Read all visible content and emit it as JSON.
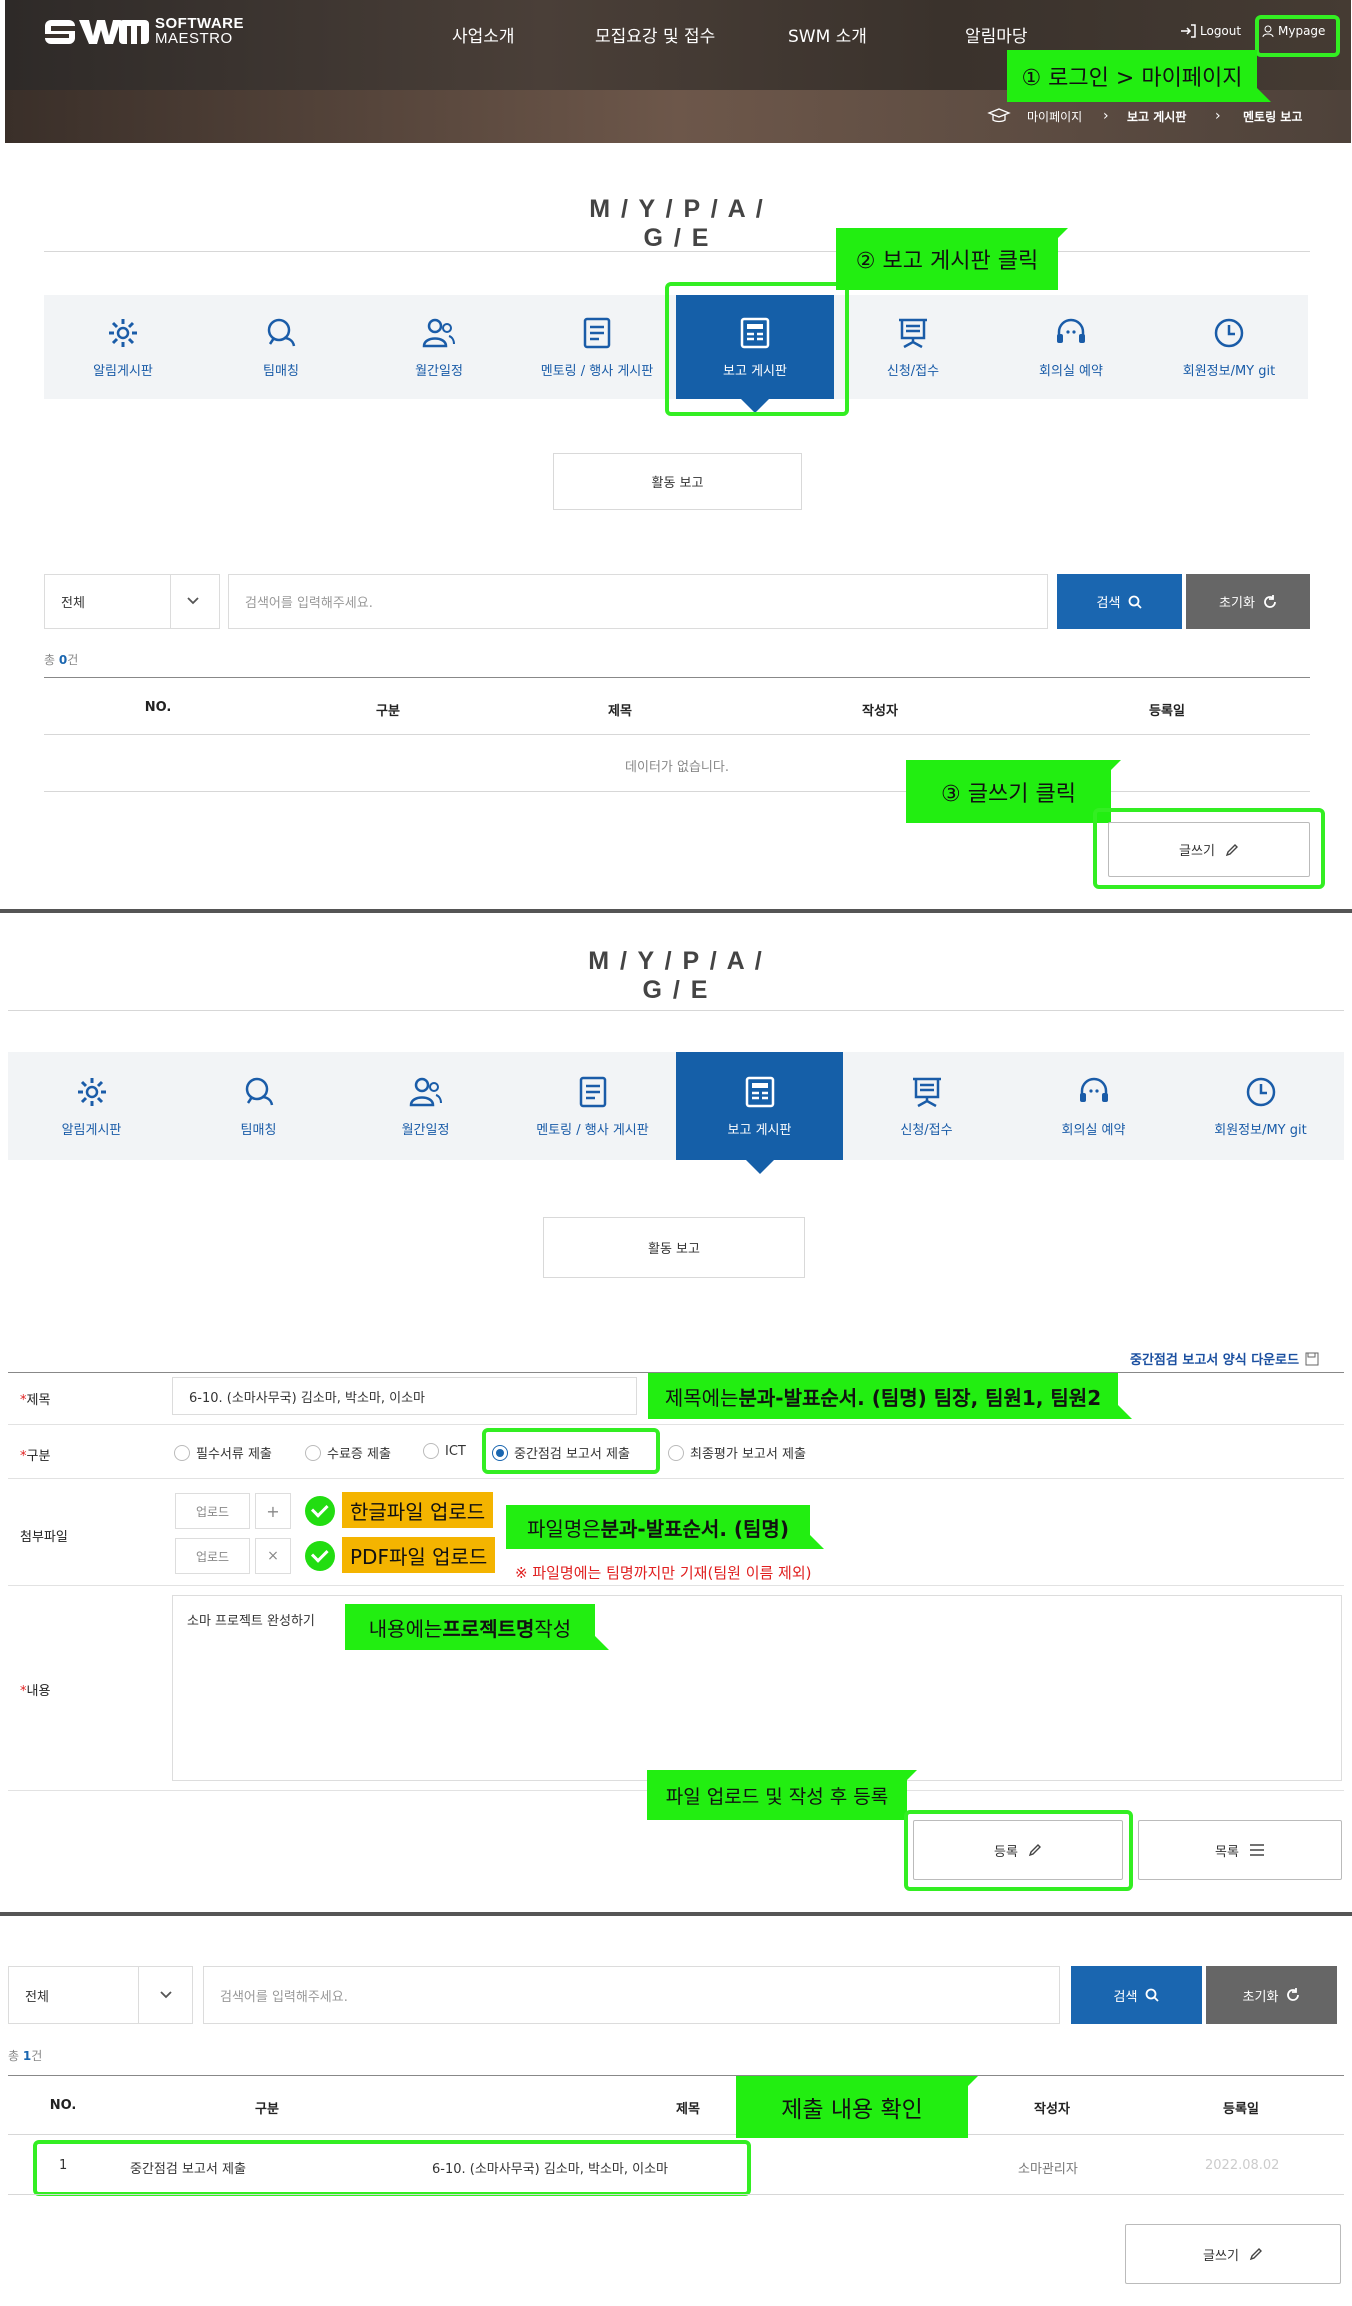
{
  "header": {
    "logo_line1": "SOFTWARE",
    "logo_line2": "MAESTRO",
    "nav": [
      "사업소개",
      "모집요강 및 접수",
      "SWM 소개",
      "알림마당"
    ],
    "logout": "Logout",
    "mypage": "Mypage",
    "breadcrumb": [
      "마이페이지",
      "보고 게시판",
      "멘토링 보고"
    ]
  },
  "mypage_title": "M / Y / P / A / G / E",
  "tabs": [
    "알림게시판",
    "팀매칭",
    "월간일정",
    "멘토링 / 행사 게시판",
    "보고 게시판",
    "신청/접수",
    "회의실 예약",
    "회원정보/MY git"
  ],
  "sub_tab": "활동 보고",
  "search": {
    "select_value": "전체",
    "placeholder": "검색어를 입력해주세요.",
    "search_label": "검색",
    "reset_label": "초기화"
  },
  "list1": {
    "total_prefix": "총 ",
    "total_count": "0",
    "total_suffix": "건",
    "columns": [
      "NO.",
      "구분",
      "제목",
      "작성자",
      "등록일"
    ],
    "empty": "데이터가 없습니다."
  },
  "write_label": "글쓰기",
  "annotations": {
    "step1": "① 로그인 > 마이페이지",
    "step2": "② 보고 게시판 클릭",
    "step3": "③ 글쓰기 클릭",
    "title_note_plain": "제목에는 ",
    "title_note_bold": "분과-발표순서. (팀명) 팀장, 팀원1, 팀원2",
    "hwp_note": "한글파일 업로드",
    "pdf_note": "PDF파일 업로드",
    "file_note_plain": "파일명은 ",
    "file_note_bold": "분과-발표순서. (팀명)",
    "file_warning": "※ 파일명에는 팀명까지만 기재(팀원 이름 제외)",
    "content_note_plain": "내용에는 ",
    "content_note_bold": "프로젝트명",
    "content_note_tail": " 작성",
    "submit_note": "파일 업로드 및 작성 후 등록",
    "check_note": "제출 내용 확인"
  },
  "form": {
    "download_link": "중간점검 보고서 양식 다운로드",
    "title_label": "제목",
    "title_value": "6-10. (소마사무국) 김소마, 박소마, 이소마",
    "category_label": "구분",
    "categories": [
      "필수서류 제출",
      "수료증 제출",
      "ICT",
      "중간점검 보고서 제출",
      "최종평가 보고서 제출"
    ],
    "selected_category": "중간점검 보고서 제출",
    "attach_label": "첨부파일",
    "upload_label": "업로드",
    "content_label": "내용",
    "content_value": "소마 프로젝트 완성하기",
    "submit_label": "등록",
    "list_label": "목록"
  },
  "list2": {
    "total_prefix": "총 ",
    "total_count": "1",
    "total_suffix": "건",
    "columns": [
      "NO.",
      "구분",
      "제목",
      "작성자",
      "등록일"
    ],
    "row": {
      "no": "1",
      "category": "중간점검 보고서 제출",
      "title": "6-10. (소마사무국) 김소마, 박소마, 이소마",
      "author": "소마관리자",
      "date": "2022.08.02"
    }
  },
  "colors": {
    "primary": "#155fa8",
    "annotation_green": "#22ee11",
    "annotation_orange": "#f4b400",
    "required": "#e02020"
  }
}
